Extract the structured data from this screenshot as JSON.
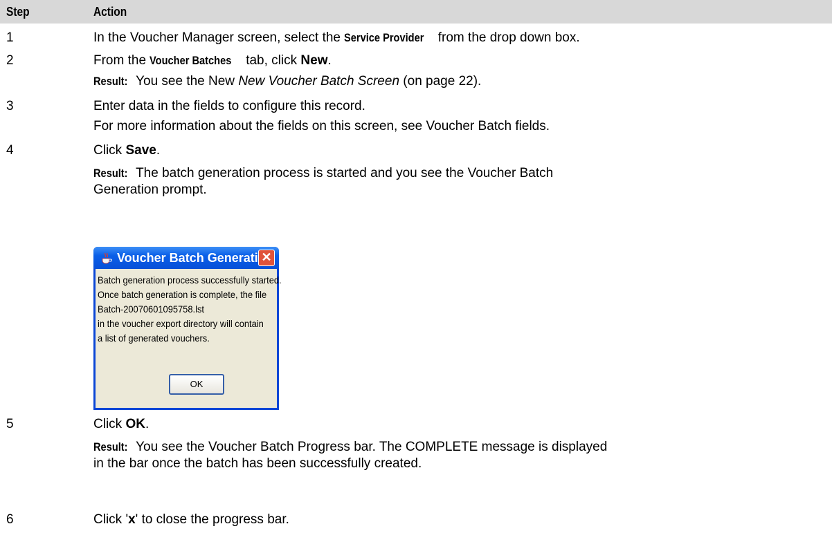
{
  "header": {
    "step": "Step",
    "action": "Action"
  },
  "steps": {
    "s1": {
      "num": "1",
      "pre": "In the Voucher Manager screen, select the ",
      "bold": "Service Provider",
      "post": " from the drop down box."
    },
    "s2": {
      "num": "2",
      "pre": "From the ",
      "bold": "Voucher Batches",
      "mid": " tab, click ",
      "bold2": "New",
      "post": ".",
      "result_label": "Result:",
      "result_pre": "You see the New ",
      "result_link": "New Voucher Batch Screen",
      "result_post": " (on page 22)."
    },
    "s3": {
      "num": "3",
      "line1": "Enter data in the fields to configure this record.",
      "line2": "For more information about the fields on this screen, see Voucher Batch fields."
    },
    "s4": {
      "num": "4",
      "pre": "Click ",
      "bold": "Save",
      "post": ".",
      "result_label": "Result:",
      "result_line1": "The batch generation process is started and you see the Voucher Batch",
      "result_line2": "Generation prompt."
    },
    "s5": {
      "num": "5",
      "pre": "Click ",
      "bold": "OK",
      "post": ".",
      "result_label": "Result:",
      "result_line1": "You see the Voucher Batch Progress bar. The COMPLETE message is displayed",
      "result_line2": "in the bar once the batch has been successfully created."
    },
    "s6": {
      "num": "6",
      "pre": "Click '",
      "bold": "x",
      "post": "' to close the progress bar."
    }
  },
  "dialog": {
    "title": "Voucher Batch Generation",
    "lines": [
      "Batch generation process successfully started.",
      "Once batch generation is complete, the file",
      "Batch-20070601095758.lst",
      "in the voucher export directory will contain",
      "a list of generated vouchers."
    ],
    "ok_label": "OK",
    "title_color": "#0a5fe8",
    "body_color": "#ece9d8"
  }
}
